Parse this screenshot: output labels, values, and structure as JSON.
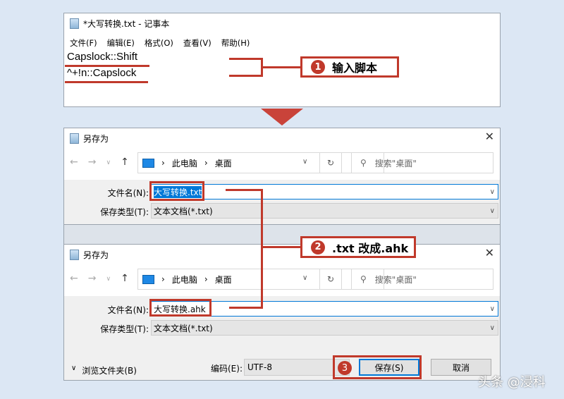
{
  "notepad": {
    "title": "*大写转换.txt - 记事本",
    "menu": [
      "文件(F)",
      "编辑(E)",
      "格式(O)",
      "查看(V)",
      "帮助(H)"
    ],
    "lines": [
      "Capslock::Shift",
      "^+!n::Capslock"
    ]
  },
  "dialog1": {
    "title": "另存为",
    "path": [
      "此电脑",
      "桌面"
    ],
    "search_placeholder": "搜索\"桌面\"",
    "filename_label": "文件名(N):",
    "filename": "大写转换.txt",
    "type_label": "保存类型(T):",
    "type": "文本文档(*.txt)"
  },
  "dialog2": {
    "title": "另存为",
    "path": [
      "此电脑",
      "桌面"
    ],
    "search_placeholder": "搜索\"桌面\"",
    "filename_label": "文件名(N):",
    "filename": "大写转换.ahk",
    "type_label": "保存类型(T):",
    "type": "文本文档(*.txt)",
    "browse": "浏览文件夹(B)",
    "encoding_label": "编码(E):",
    "encoding": "UTF-8",
    "save": "保存(S)",
    "cancel": "取消"
  },
  "annotations": [
    {
      "num": "1",
      "text": "输入脚本"
    },
    {
      "num": "2",
      "text": ".txt 改成.ahk"
    },
    {
      "num": "3"
    }
  ],
  "watermark": "头条 @浸科"
}
